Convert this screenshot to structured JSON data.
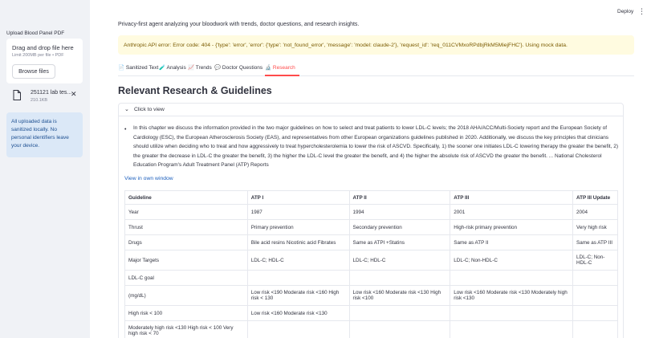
{
  "sidebar": {
    "upload_label": "Upload Blood Panel PDF",
    "dropzone_title": "Drag and drop file here",
    "dropzone_limit": "Limit 200MB per file • PDF",
    "browse_label": "Browse files",
    "file": {
      "name": "251121 lab tes...",
      "size": "210.1KB"
    },
    "info": "All uploaded data is sanitized locally. No personal identifiers leave your device."
  },
  "header": {
    "deploy_label": "Deploy"
  },
  "main": {
    "subtitle": "Privacy-first agent analyzing your bloodwork with trends, doctor questions, and research insights.",
    "warning": "Anthropic API error: Error code: 404 - {'type': 'error', 'error': {'type': 'not_found_error', 'message': 'model: claude-2'}, 'request_id': 'req_011CVMxoRPdbjRkM5MiejFHC'}. Using mock data.",
    "tabs": [
      {
        "icon": "📄",
        "label": "Sanitized Text"
      },
      {
        "icon": "🧪",
        "label": "Analysis"
      },
      {
        "icon": "📈",
        "label": "Trends"
      },
      {
        "icon": "💬",
        "label": "Doctor Questions"
      },
      {
        "icon": "🔬",
        "label": "Research"
      }
    ],
    "heading": "Relevant Research & Guidelines",
    "expander_label": "Click to view",
    "bullet": "In this chapter we discuss the information provided in the two major guidelines on how to select and treat patients to lower LDL-C levels; the 2018 AHA/ACC/Multi-Society report and the European Society of Cardiology (ESC), the European Atherosclerosis Society (EAS), and representatives from other European organizations guidelines published in 2020. Additionally, we discuss the key principles that clinicians should utilize when deciding who to treat and how aggressively to treat hypercholesterolemia to lower the risk of ASCVD. Specifically, 1) the sooner one initiates LDL-C lowering therapy the greater the benefit, 2) the greater the decrease in LDL-C the greater the benefit, 3) the higher the LDL-C level the greater the benefit, and 4) the higher the absolute risk of ASCVD the greater the benefit. ... National Cholesterol Education Program's Adult Treatment Panel (ATP) Reports",
    "link": "View in own window",
    "table": {
      "headers": [
        "Guideline",
        "ATP I",
        "ATP II",
        "ATP III",
        "ATP III Update"
      ],
      "rows": [
        [
          "Year",
          "1987",
          "1994",
          "2001",
          "2004"
        ],
        [
          "Thrust",
          "Primary prevention",
          "Secondary prevention",
          "High-risk primary prevention",
          "Very high risk"
        ],
        [
          "Drugs",
          "Bile acid resins Nicotinic acid Fibrates",
          "Same as ATPI +Statins",
          "Same as ATP II",
          "Same as ATP III"
        ],
        [
          "Major Targets",
          "LDL-C; HDL-C",
          "LDL-C; HDL-C",
          "LDL-C; Non-HDL-C",
          "LDL-C; Non-HDL-C"
        ],
        [
          "LDL-C goal",
          "",
          "",
          "",
          ""
        ],
        [
          "(mg/dL)",
          "Low risk <190 Moderate risk <160 High risk < 130",
          "Low risk <160 Moderate risk <130 High risk <100",
          "Low risk <160 Moderate risk <130 Moderately high risk <130",
          ""
        ],
        [
          "High risk < 100",
          "Low risk <160 Moderate risk <130",
          "",
          "",
          ""
        ],
        [
          "Moderately high risk <130 High risk < 100 Very high risk < 70",
          "",
          "",
          "",
          ""
        ]
      ]
    }
  }
}
